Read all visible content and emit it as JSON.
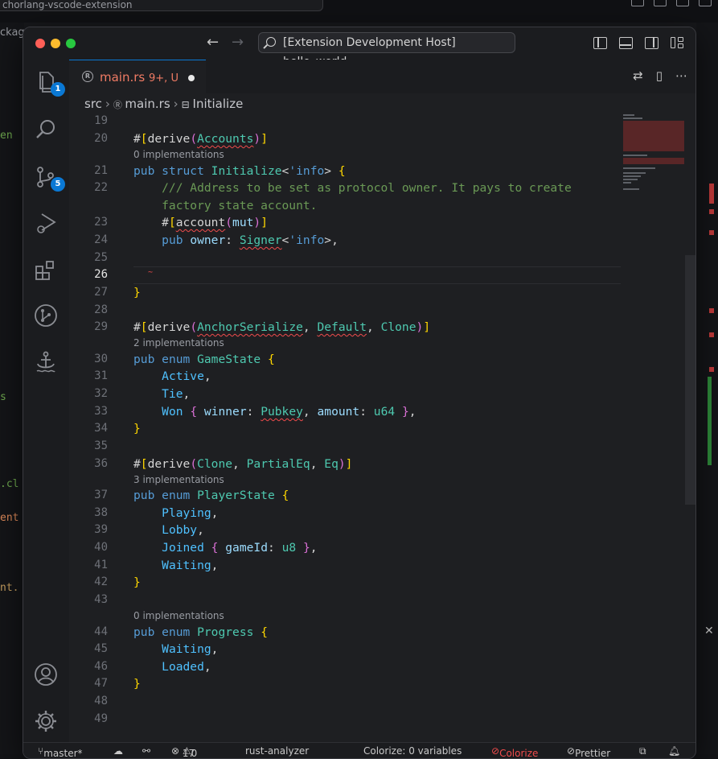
{
  "background": {
    "tab_title": "chorlang-vscode-extension",
    "side_fragments": [
      "ckag",
      "en",
      "s",
      ".cl",
      "ent",
      "nt."
    ]
  },
  "titlebar": {
    "command_center": "[Extension Development Host] hello_world"
  },
  "activity_bar": {
    "explorer_badge": "1",
    "scm_badge": "5"
  },
  "tab": {
    "filename": "main.rs",
    "status": "9+, U"
  },
  "breadcrumb": {
    "folder": "src",
    "file": "main.rs",
    "symbol": "Initialize"
  },
  "code_lines": [
    {
      "n": "19",
      "text": ""
    },
    {
      "n": "20",
      "lens": "0 implementations"
    },
    {
      "n": "21"
    },
    {
      "n": "22",
      "text": "    /// Address to be set as protocol owner. It pays to create"
    },
    {
      "n": "",
      "text": "    factory state account."
    },
    {
      "n": "23"
    },
    {
      "n": "24"
    },
    {
      "n": "25"
    },
    {
      "n": "26"
    },
    {
      "n": "27"
    },
    {
      "n": "28"
    },
    {
      "n": "29",
      "lens": "2 implementations"
    },
    {
      "n": "30"
    },
    {
      "n": "31"
    },
    {
      "n": "32"
    },
    {
      "n": "33"
    },
    {
      "n": "34"
    },
    {
      "n": "35"
    },
    {
      "n": "36",
      "lens": "3 implementations"
    },
    {
      "n": "37"
    },
    {
      "n": "38"
    },
    {
      "n": "39"
    },
    {
      "n": "40"
    },
    {
      "n": "41"
    },
    {
      "n": "42"
    },
    {
      "n": "43"
    },
    {
      "n": "44",
      "lens": "0 implementations"
    },
    {
      "n": "45"
    },
    {
      "n": "46"
    },
    {
      "n": "47"
    },
    {
      "n": "48"
    },
    {
      "n": "49"
    }
  ],
  "code": {
    "l20_derive": "derive",
    "l20_accounts": "Accounts",
    "l21_pub": "pub",
    "l21_struct": "struct",
    "l21_name": "Initialize",
    "l21_lt": "'info",
    "l23_account": "account",
    "l23_mut": "mut",
    "l24_pub": "pub",
    "l24_field": "owner",
    "l24_type": "Signer",
    "l24_lt": "'info",
    "l29_derive": "derive",
    "l29_a": "AnchorSerialize",
    "l29_b": "Default",
    "l29_c": "Clone",
    "l30_pub": "pub",
    "l30_enum": "enum",
    "l30_name": "GameState",
    "l31": "Active",
    "l32": "Tie",
    "l33_won": "Won",
    "l33_winner": "winner",
    "l33_pubkey": "Pubkey",
    "l33_amount": "amount",
    "l33_u64": "u64",
    "l36_derive": "derive",
    "l36_a": "Clone",
    "l36_b": "PartialEq",
    "l36_c": "Eq",
    "l37_pub": "pub",
    "l37_enum": "enum",
    "l37_name": "PlayerState",
    "l38": "Playing",
    "l39": "Lobby",
    "l40_joined": "Joined",
    "l40_field": "gameId",
    "l40_type": "u8",
    "l41": "Waiting",
    "l44_pub": "pub",
    "l44_enum": "enum",
    "l44_name": "Progress",
    "l45": "Waiting",
    "l46": "Loaded"
  },
  "status_bar": {
    "branch": "master*",
    "errors": "17",
    "warnings": "0",
    "analyzer": "rust-analyzer",
    "colorize": "Colorize: 0 variables",
    "colorize_btn": "Colorize",
    "prettier": "Prettier"
  },
  "colors": {
    "accent": "#0a78d4",
    "tab_modified": "#f07b64",
    "error": "#f14c4c"
  }
}
